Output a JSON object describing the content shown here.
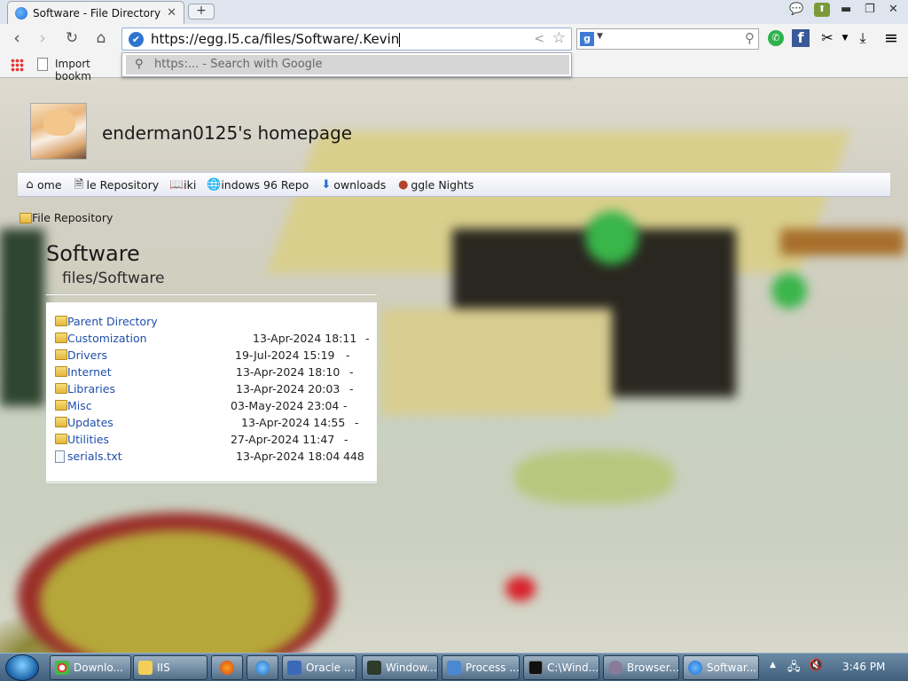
{
  "browser": {
    "tab_title": "Software - File Directory",
    "tab_close": "✕",
    "new_tab": "+",
    "url": "https://egg.l5.ca/files/Software/.Kevin",
    "suggestion": "https:... - Search with Google",
    "bookmark_label": "Import bookm"
  },
  "site": {
    "title": "enderman0125's homepage",
    "nav": [
      {
        "label": "ome",
        "icon": "home-icon"
      },
      {
        "label": "le Repository",
        "icon": "file-icon"
      },
      {
        "label": "iki",
        "icon": "book-icon"
      },
      {
        "label": "indows 96 Repo",
        "icon": "globe-icon"
      },
      {
        "label": "ownloads",
        "icon": "download-arrow-icon"
      },
      {
        "label": "ggle Nights",
        "icon": "egg-icon"
      }
    ],
    "breadcrumb": "File Repository",
    "heading": "Software",
    "subheading": "files/Software"
  },
  "listing": {
    "rows": [
      {
        "name": "Parent Directory",
        "date": "",
        "size": "",
        "kind": "folder"
      },
      {
        "name": "Customization",
        "date": "13-Apr-2024 18:11",
        "size": "-",
        "kind": "folder"
      },
      {
        "name": "Drivers",
        "date": "19-Jul-2024 15:19",
        "size": "-",
        "kind": "folder"
      },
      {
        "name": "Internet",
        "date": "13-Apr-2024 18:10",
        "size": "-",
        "kind": "folder"
      },
      {
        "name": "Libraries",
        "date": "13-Apr-2024 20:03",
        "size": "-",
        "kind": "folder"
      },
      {
        "name": "Misc",
        "date": "03-May-2024 23:04",
        "size": "-",
        "kind": "folder"
      },
      {
        "name": "Updates",
        "date": "13-Apr-2024 14:55",
        "size": "-",
        "kind": "folder"
      },
      {
        "name": "Utilities",
        "date": "27-Apr-2024 11:47",
        "size": "-",
        "kind": "folder"
      },
      {
        "name": "serials.txt",
        "date": "13-Apr-2024 18:04",
        "size": "448",
        "kind": "file"
      }
    ]
  },
  "taskbar": {
    "items": [
      {
        "label": "Downlo...",
        "icon": "chrome-icon"
      },
      {
        "label": "IIS",
        "icon": "folder-icon"
      },
      {
        "label": "",
        "icon": "firefox-icon"
      },
      {
        "label": "",
        "icon": "ie-icon"
      },
      {
        "label": "Oracle ...",
        "icon": "virtualbox-icon"
      },
      {
        "label": "Window...",
        "icon": "window-icon"
      },
      {
        "label": "Process ...",
        "icon": "process-icon"
      },
      {
        "label": "C:\\Wind...",
        "icon": "cmd-icon"
      },
      {
        "label": "Browser...",
        "icon": "browser-icon"
      },
      {
        "label": "Softwar...",
        "icon": "software-icon"
      }
    ],
    "clock": "3:46 PM"
  },
  "colors": {
    "link": "#1f4fa8",
    "taskbar": "#3f5f7c",
    "omnibox_border": "#8fb1d8"
  }
}
